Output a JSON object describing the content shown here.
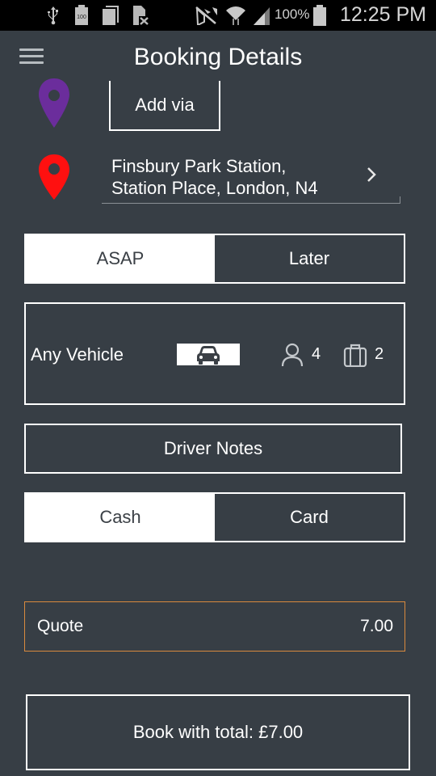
{
  "status_bar": {
    "icons": [
      "usb-icon",
      "battery-100-icon",
      "notification-card-icon",
      "no-sim-icon",
      "mute-icon",
      "wifi-icon",
      "signal-icon",
      "battery-icon"
    ],
    "battery_badge": "100",
    "battery_percent": "100%",
    "time": "12:25 PM"
  },
  "header": {
    "title": "Booking Details",
    "menu_icon": "hamburger-menu-icon"
  },
  "route": {
    "via_pin_color": "#6b2d9c",
    "add_via_label": "Add via",
    "destination_pin_color": "#ff1010",
    "destination": {
      "line1": "Finsbury Park Station,",
      "line2": "Station Place, London, N4"
    }
  },
  "timing": {
    "options": [
      {
        "label": "ASAP",
        "selected": true
      },
      {
        "label": "Later",
        "selected": false
      }
    ]
  },
  "vehicle": {
    "label": "Any Vehicle",
    "icon": "car-icon",
    "passengers": "4",
    "luggage": "2"
  },
  "driver_notes_label": "Driver Notes",
  "payment": {
    "options": [
      {
        "label": "Cash",
        "selected": true
      },
      {
        "label": "Card",
        "selected": false
      }
    ]
  },
  "quote": {
    "label": "Quote",
    "value": "7.00",
    "border_color": "#d98a3e"
  },
  "book_button_label": "Book with total: £7.00"
}
